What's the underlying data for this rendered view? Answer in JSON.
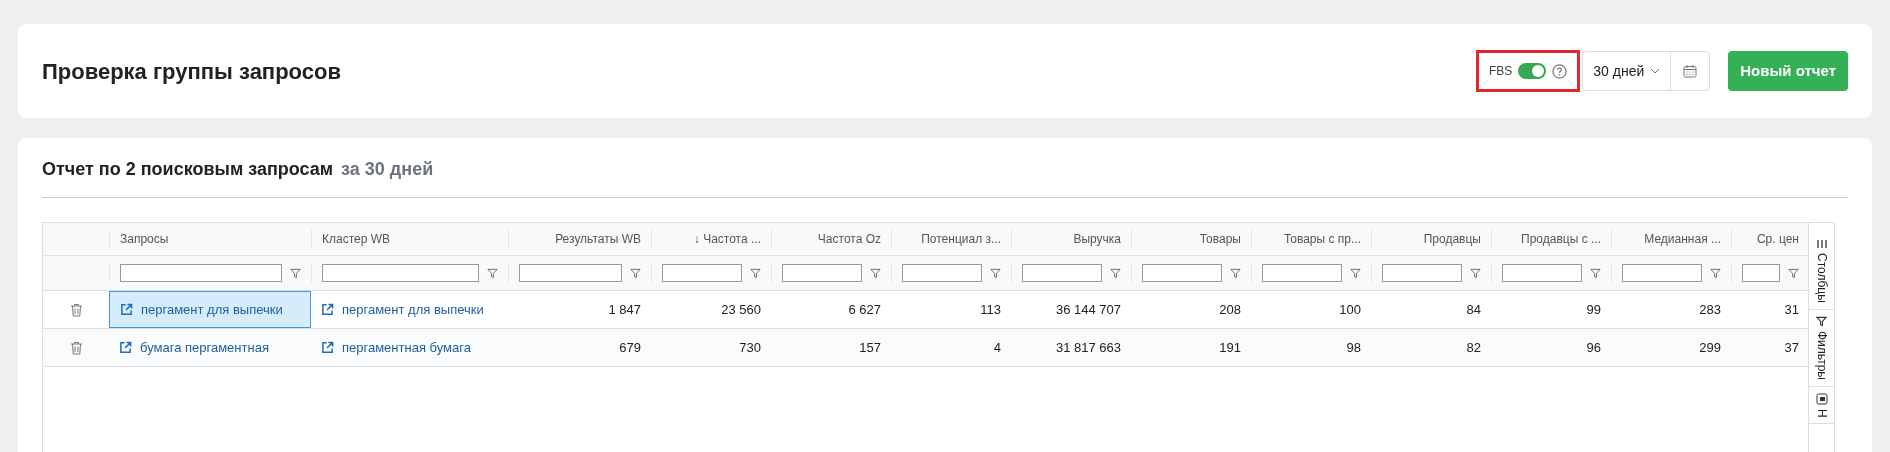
{
  "page_title": "Проверка группы запросов",
  "fbs": {
    "label": "FBS",
    "on": true
  },
  "period": {
    "value": "30 дней"
  },
  "new_report_button": "Новый отчет",
  "report": {
    "title": "Отчет по 2 поисковым запросам",
    "period": "за 30 дней"
  },
  "table": {
    "columns": [
      {},
      {
        "label": "Запросы"
      },
      {
        "label": "Кластер WB"
      },
      {
        "label": "Результаты WB"
      },
      {
        "label": "↓ Частота ..."
      },
      {
        "label": "Частота Oz"
      },
      {
        "label": "Потенциал з..."
      },
      {
        "label": "Выручка"
      },
      {
        "label": "Товары"
      },
      {
        "label": "Товары с пр..."
      },
      {
        "label": "Продавцы"
      },
      {
        "label": "Продавцы с ..."
      },
      {
        "label": "Медианная ..."
      },
      {
        "label": "Ср. цен"
      }
    ],
    "rows": [
      {
        "query": "пергамент для выпечки",
        "query_selected": true,
        "cluster": "пергамент для выпечки",
        "values": [
          "1 847",
          "23 560",
          "6 627",
          "113",
          "36 144 707",
          "208",
          "100",
          "84",
          "99",
          "283",
          "31"
        ]
      },
      {
        "query": "бумага пергаментная",
        "query_selected": false,
        "cluster": "пергаментная бумага",
        "values": [
          "679",
          "730",
          "157",
          "4",
          "31 817 663",
          "191",
          "98",
          "82",
          "96",
          "299",
          "37"
        ]
      }
    ]
  },
  "side_tabs": [
    {
      "kind": "columns",
      "label": "Столбцы"
    },
    {
      "kind": "filters",
      "label": "Фильтры"
    },
    {
      "kind": "pivot",
      "label": "Н"
    }
  ]
}
